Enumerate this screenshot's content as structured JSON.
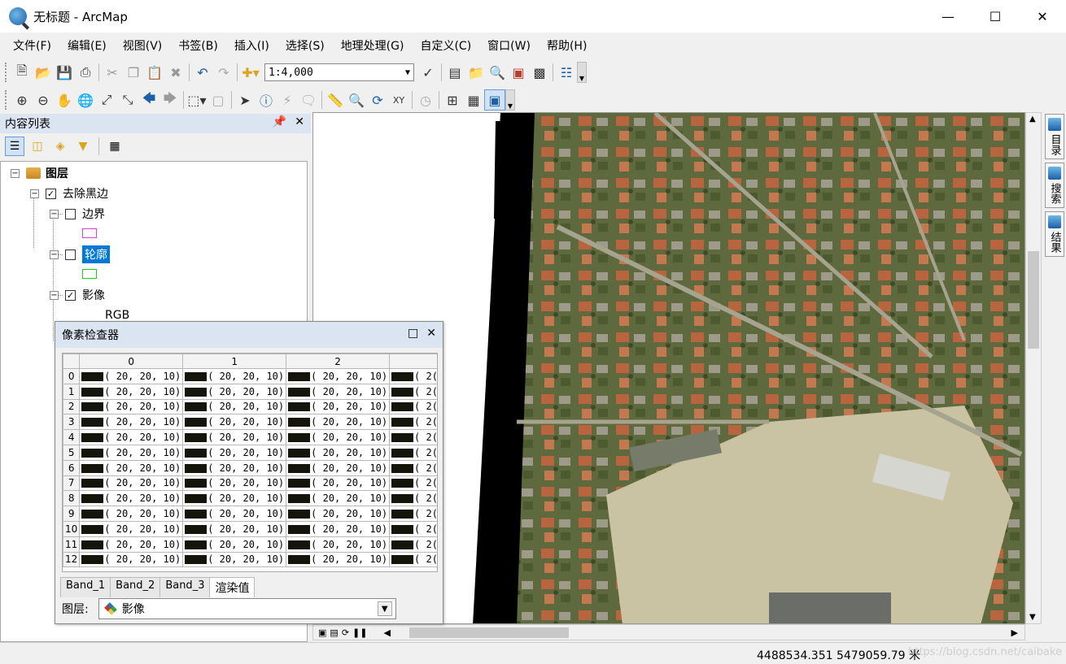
{
  "window": {
    "title": "无标题 - ArcMap"
  },
  "menu": [
    "文件(F)",
    "编辑(E)",
    "视图(V)",
    "书签(B)",
    "插入(I)",
    "选择(S)",
    "地理处理(G)",
    "自定义(C)",
    "窗口(W)",
    "帮助(H)"
  ],
  "toolbar": {
    "scale": "1:4,000"
  },
  "toc": {
    "title": "内容列表",
    "root": "图层",
    "group": "去除黑边",
    "layers": [
      {
        "name": "边界",
        "checked": false,
        "swatch": "#e040e0"
      },
      {
        "name": "轮廓",
        "checked": false,
        "swatch": "#20d020",
        "selected": true
      },
      {
        "name": "影像",
        "checked": true
      }
    ],
    "rgb_label": "RGB"
  },
  "inspector": {
    "title": "像素检查器",
    "columns": [
      "0",
      "1",
      "2",
      ""
    ],
    "rows": [
      "0",
      "1",
      "2",
      "3",
      "4",
      "5",
      "6",
      "7",
      "8",
      "9",
      "10",
      "11",
      "12"
    ],
    "cell_value": "( 20,  20,  10)",
    "cell_partial": "( 2(",
    "tabs": [
      "Band_1",
      "Band_2",
      "Band_3",
      "渲染值"
    ],
    "active_tab": "渲染值",
    "layer_label": "图层:",
    "layer_value": "影像"
  },
  "dock": [
    "目录",
    "搜索",
    "结果"
  ],
  "status": {
    "coords": "4488534.351  5479059.79 米",
    "watermark": "https://blog.csdn.net/caibake"
  },
  "colors": {
    "accent": "#0078d7",
    "panel_header": "#dbe4f1",
    "pixel_swatch": "#14140a"
  }
}
